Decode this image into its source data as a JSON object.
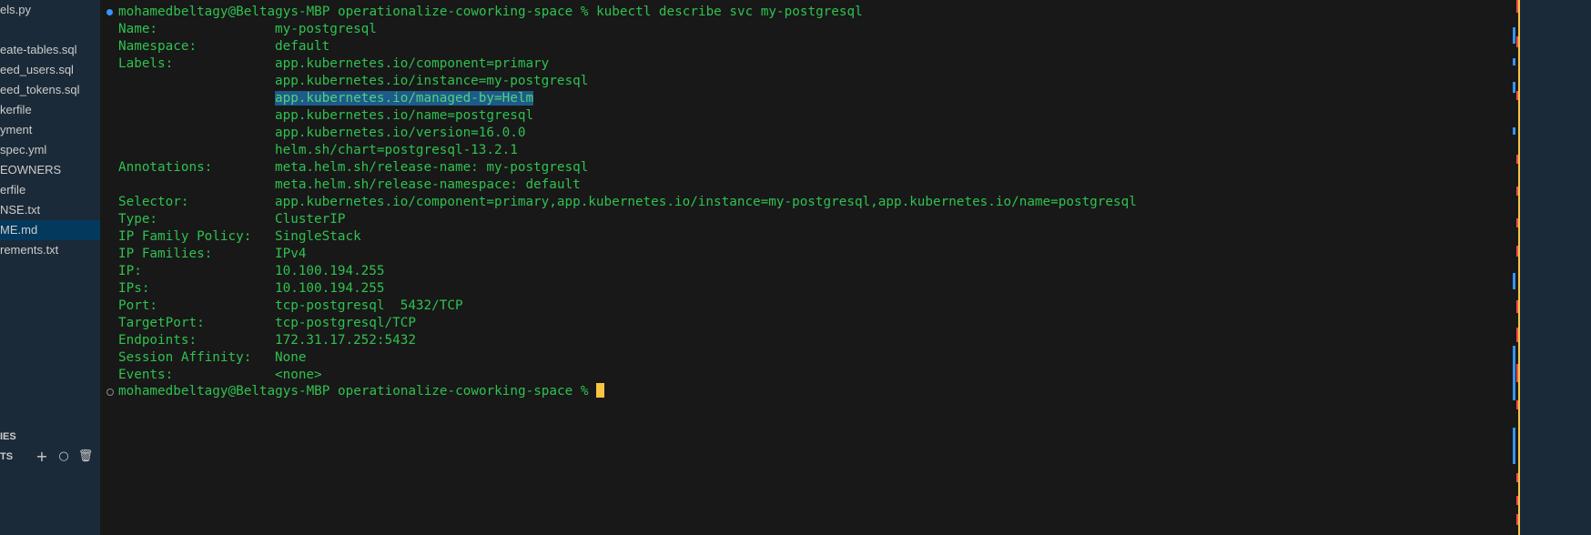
{
  "sidebar": {
    "files": [
      {
        "label": "els.py",
        "selected": false
      },
      {
        "label": "eate-tables.sql",
        "selected": false
      },
      {
        "label": "eed_users.sql",
        "selected": false
      },
      {
        "label": "eed_tokens.sql",
        "selected": false
      },
      {
        "label": "kerfile",
        "selected": false
      },
      {
        "label": "yment",
        "selected": false
      },
      {
        "label": "spec.yml",
        "selected": false
      },
      {
        "label": "EOWNERS",
        "selected": false
      },
      {
        "label": "erfile",
        "selected": false
      },
      {
        "label": "NSE.txt",
        "selected": false
      },
      {
        "label": "ME.md",
        "selected": true
      },
      {
        "label": "rements.txt",
        "selected": false
      }
    ],
    "section_a": "IES",
    "section_b": "TS",
    "icons": {
      "add": "+",
      "circle": "○",
      "trash": "🗑"
    }
  },
  "terminal": {
    "prompt": "mohamedbeltagy@Beltagys-MBP operationalize-coworking-space % ",
    "command": "kubectl describe svc my-postgresql",
    "fields": [
      {
        "key": "Name:",
        "value": "my-postgresql"
      },
      {
        "key": "Namespace:",
        "value": "default"
      },
      {
        "key": "Labels:",
        "value": "app.kubernetes.io/component=primary"
      },
      {
        "key": "",
        "value": "app.kubernetes.io/instance=my-postgresql"
      },
      {
        "key": "",
        "value": "app.kubernetes.io/managed-by=Helm",
        "highlight": true
      },
      {
        "key": "",
        "value": "app.kubernetes.io/name=postgresql"
      },
      {
        "key": "",
        "value": "app.kubernetes.io/version=16.0.0"
      },
      {
        "key": "",
        "value": "helm.sh/chart=postgresql-13.2.1"
      },
      {
        "key": "Annotations:",
        "value": "meta.helm.sh/release-name: my-postgresql"
      },
      {
        "key": "",
        "value": "meta.helm.sh/release-namespace: default"
      },
      {
        "key": "Selector:",
        "value": "app.kubernetes.io/component=primary,app.kubernetes.io/instance=my-postgresql,app.kubernetes.io/name=postgresql"
      },
      {
        "key": "Type:",
        "value": "ClusterIP"
      },
      {
        "key": "IP Family Policy:",
        "value": "SingleStack"
      },
      {
        "key": "IP Families:",
        "value": "IPv4"
      },
      {
        "key": "IP:",
        "value": "10.100.194.255"
      },
      {
        "key": "IPs:",
        "value": "10.100.194.255"
      },
      {
        "key": "Port:",
        "value": "tcp-postgresql  5432/TCP"
      },
      {
        "key": "TargetPort:",
        "value": "tcp-postgresql/TCP"
      },
      {
        "key": "Endpoints:",
        "value": "172.31.17.252:5432"
      },
      {
        "key": "Session Affinity:",
        "value": "None"
      },
      {
        "key": "Events:",
        "value": "<none>"
      }
    ],
    "final_prompt": "mohamedbeltagy@Beltagys-MBP operationalize-coworking-space % "
  },
  "colors": {
    "terminal_text": "#2fc14f",
    "selection": "#1e5a8a",
    "cursor": "#f6c343",
    "sidebar_bg": "#1b2a38",
    "terminal_bg": "#181818"
  }
}
